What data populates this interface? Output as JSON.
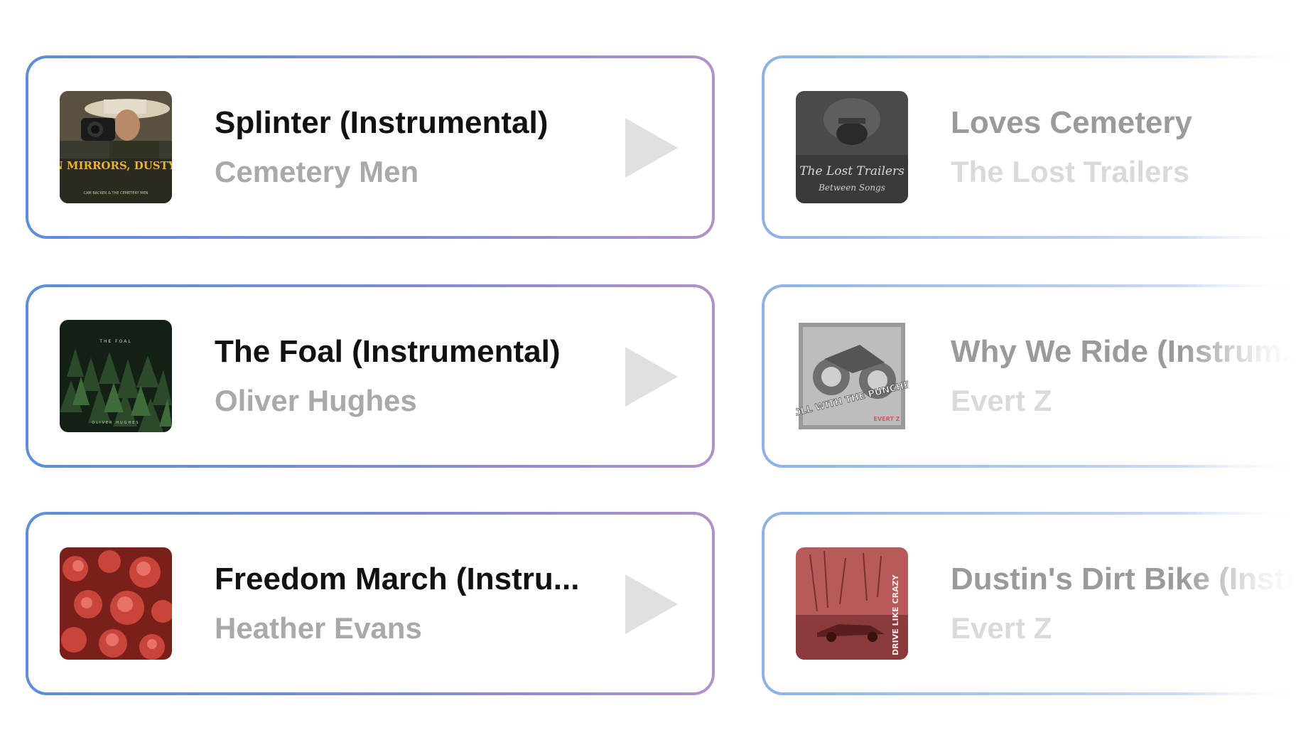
{
  "tracks": [
    {
      "title": "Splinter (Instrumental)",
      "artist": "Cemetery Men",
      "art_label": "BROKEN MIRRORS, DUSTY ROADS",
      "art_sublabel": "CAM BACKER & THE CEMETERY MEN"
    },
    {
      "title": "Loves Cemetery",
      "artist": "The Lost Trailers",
      "art_label": "The Lost Trailers",
      "art_sublabel": "Between Songs"
    },
    {
      "title": "The Foal (Instrumental)",
      "artist": "Oliver Hughes",
      "art_label": "THE FOAL",
      "art_sublabel": "OLIVER HUGHES"
    },
    {
      "title": "Why We Ride (Instrum...",
      "artist": "Evert Z",
      "art_label": "ROLL WITH THE PUNCHES",
      "art_sublabel": "EVERT Z"
    },
    {
      "title": "Freedom March (Instru...",
      "artist": "Heather Evans",
      "art_label": "",
      "art_sublabel": ""
    },
    {
      "title": "Dustin's Dirt Bike (Instr...",
      "artist": "Evert Z",
      "art_label": "DRIVE LIKE CRAZY",
      "art_sublabel": ""
    }
  ],
  "colors": {
    "active_border_start": "#5b8fdb",
    "active_border_end": "#b391c9",
    "title": "#111111",
    "artist": "#a9a9a9",
    "play_icon": "#e0e0e0"
  }
}
